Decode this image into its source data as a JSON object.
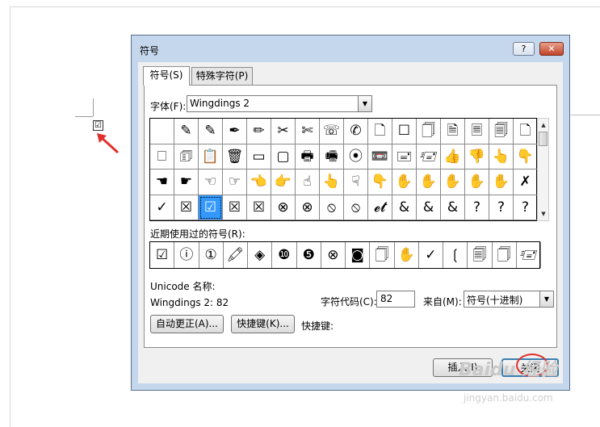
{
  "document": {
    "checkbox_glyph": "☑"
  },
  "dialog": {
    "title": "符号",
    "help_label": "?",
    "close_label": "✕",
    "tabs": [
      {
        "label": "符号(S)"
      },
      {
        "label": "特殊字符(P)"
      }
    ],
    "font": {
      "label": "字体(F):",
      "value": "Wingdings 2"
    },
    "grid": [
      "",
      "✎",
      "✎",
      "✒",
      "✏",
      "✂",
      "✄",
      "☏",
      "✆",
      "🗋",
      "☐",
      "🗍",
      "🗎",
      "🗏",
      "🗐",
      "🗋",
      "🗆",
      "🗊",
      "📋",
      "🗑",
      "▭",
      "▢",
      "🖶",
      "🖷",
      "⦿",
      "📼",
      "🖃",
      "🖅",
      "👍",
      "👎",
      "👆",
      "👇",
      "☚",
      "☛",
      "☜",
      "☞",
      "👈",
      "👉",
      "☝",
      "👆",
      "☟",
      "👇",
      "✋",
      "✋",
      "✋",
      "✋",
      "✋",
      "✗",
      "✓",
      "☒",
      "☑",
      "☒",
      "☒",
      "⊗",
      "⊗",
      "⦸",
      "⦸",
      "𝓮𝓽",
      "&",
      "&",
      "&",
      "?",
      "?",
      "?"
    ],
    "recent_label": "近期使用过的符号(R):",
    "recent": [
      "☑",
      "ⓘ",
      "①",
      "🖍",
      "◈",
      "❿",
      "❺",
      "⊗",
      "◙",
      "🗍",
      "✋",
      "✓",
      "❲",
      "🗐",
      "🗍",
      "🖅"
    ],
    "unicode_name_label": "Unicode 名称:",
    "unicode_name_value": "Wingdings 2: 82",
    "char_code": {
      "label": "字符代码(C):",
      "value": "82"
    },
    "from": {
      "label": "来自(M):",
      "value": "符号(十进制)"
    },
    "autocorrect_label": "自动更正(A)...",
    "shortcut_key_label": "快捷键(K)...",
    "shortcut_text": "快捷键:",
    "insert_label": "插入(I)",
    "close_button_label": "关闭"
  },
  "watermark": {
    "line1": "Baidu 经验",
    "line2": "jingyan.baidu.com"
  },
  "colors": {
    "selection": "#3399ff",
    "annotation": "#e0302a",
    "dialog_frame": "#c5d7ec"
  }
}
